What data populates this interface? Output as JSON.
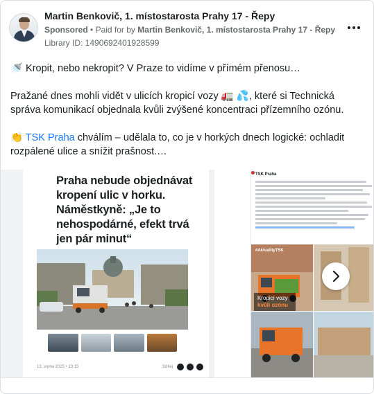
{
  "post": {
    "page_name": "Martin Benkovič, 1. místostarosta Prahy 17 - Řepy",
    "sponsored_label": "Sponsored",
    "paid_for_prefix": "Paid for by",
    "paid_for_name": "Martin Benkovič, 1. místostarosta Prahy 17 - Řepy",
    "library_id": "Library ID: 1490692401928599",
    "more_icon": "more-horizontal-icon"
  },
  "body": {
    "line1_emoji": "🚿",
    "line1_text": "Kropit, nebo nekropit? V Praze to vidíme v přímém přenosu…",
    "para2_a": "Pražané dnes mohli vidět v ulicích kropicí vozy",
    "para2_emoji1": "🚛",
    "para2_emoji2": "💦",
    "para2_b": ", které si Technická správa komunikací objednala kvůli zvýšené koncentraci přízemního ozónu.",
    "para3_emoji": "👏",
    "para3_link": "TSK Praha",
    "para3_text": "chválím – udělala to, co je v horkých dnech logické: ochladit rozpálené ulice a snížit prašnost.…"
  },
  "carousel": {
    "slide1": {
      "headline": "Praha nebude objednávat kropení ulic v horku. Náměstkyně: „Je to nehospodárné, efekt trvá jen pár minut“",
      "date": "13. srpna 2025 • 13:15",
      "share_label": "Sdílej"
    },
    "slide2": {
      "page": "TSK Praha",
      "tag": "#AktualityTSK",
      "caption_line1": "Kropicí vozy",
      "caption_line2": "kvůli ozónu"
    },
    "next_icon": "chevron-right-icon"
  },
  "colors": {
    "link": "#1877f2",
    "text": "#1c1e21",
    "secondary": "#65676b",
    "tsk_orange": "#e8742a"
  }
}
